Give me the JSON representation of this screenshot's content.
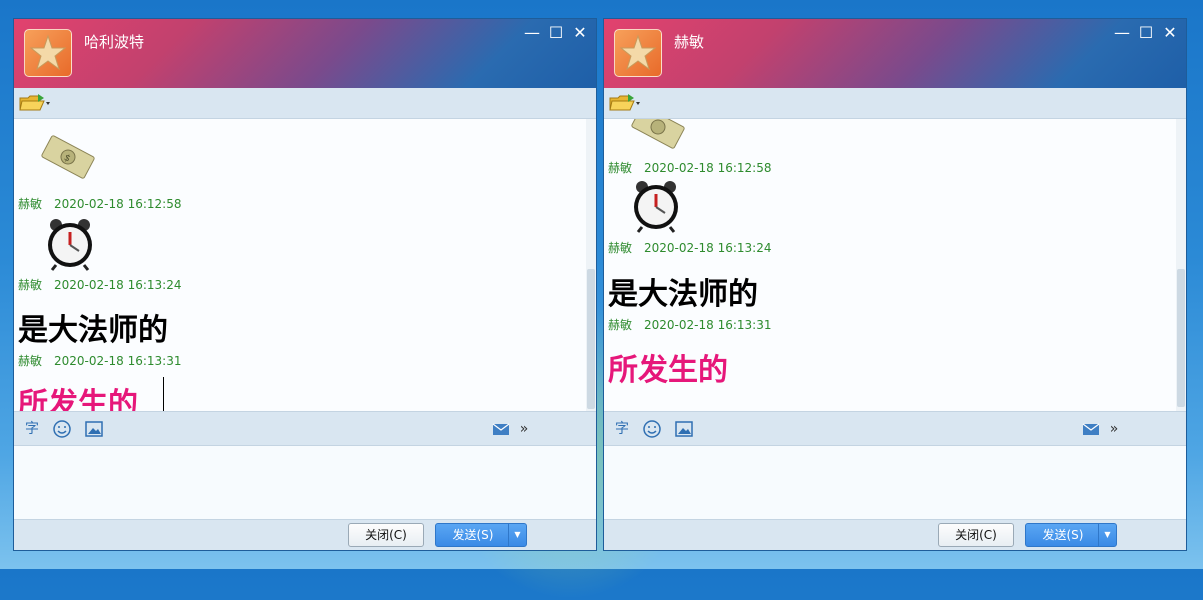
{
  "window_left": {
    "title": "哈利波特",
    "messages": [
      {
        "sender": "赫敏",
        "time": "2020-02-18 16:12:58"
      },
      {
        "sender": "赫敏",
        "time": "2020-02-18 16:13:24"
      },
      {
        "text": "是大法师的"
      },
      {
        "sender": "赫敏",
        "time": "2020-02-18 16:13:31"
      },
      {
        "text": "所发生的"
      }
    ],
    "close_label": "关闭(C)",
    "send_label": "发送(S)"
  },
  "window_right": {
    "title": "赫敏",
    "messages": [
      {
        "sender": "赫敏",
        "time": "2020-02-18 16:12:58"
      },
      {
        "sender": "赫敏",
        "time": "2020-02-18 16:13:24"
      },
      {
        "text": "是大法师的"
      },
      {
        "sender": "赫敏",
        "time": "2020-02-18 16:13:31"
      },
      {
        "text": "所发生的"
      }
    ],
    "close_label": "关闭(C)",
    "send_label": "发送(S)"
  },
  "toolbar_icons": [
    "folder-icon",
    "font-icon",
    "emoji-icon",
    "image-icon",
    "envelope-icon",
    "more-icon"
  ],
  "msgbar": {
    "font_glyph": "字",
    "more_glyph": "»"
  },
  "window_controls": {
    "min": "—",
    "max": "☐",
    "close": "✕"
  },
  "colors": {
    "sender_green": "#2e8b2e",
    "pink_text": "#e6177a",
    "send_blue": "#3a8ae6"
  }
}
